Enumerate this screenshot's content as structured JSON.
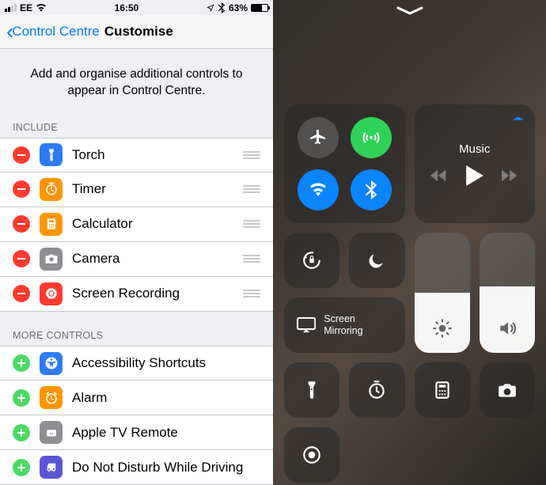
{
  "status": {
    "carrier": "EE",
    "time": "16:50",
    "battery_pct": "63%"
  },
  "nav": {
    "back_label": "Control Centre",
    "title": "Customise"
  },
  "description": "Add and organise additional controls to appear in Control Centre.",
  "section_include": "INCLUDE",
  "section_more": "MORE CONTROLS",
  "include": [
    {
      "label": "Torch",
      "icon": "torch",
      "color": "#2f7bf6"
    },
    {
      "label": "Timer",
      "icon": "timer",
      "color": "#ff9500"
    },
    {
      "label": "Calculator",
      "icon": "calculator",
      "color": "#ff9500"
    },
    {
      "label": "Camera",
      "icon": "camera",
      "color": "#8e8e93"
    },
    {
      "label": "Screen Recording",
      "icon": "record",
      "color": "#ff3b30"
    }
  ],
  "more": [
    {
      "label": "Accessibility Shortcuts",
      "icon": "accessibility",
      "color": "#2f7bf6"
    },
    {
      "label": "Alarm",
      "icon": "alarm",
      "color": "#ff9500"
    },
    {
      "label": "Apple TV Remote",
      "icon": "tv",
      "color": "#8e8e93"
    },
    {
      "label": "Do Not Disturb While Driving",
      "icon": "car-dnd",
      "color": "#5856d6"
    }
  ],
  "cc": {
    "music_label": "Music",
    "mirror_label": "Screen Mirroring",
    "brightness_pct": 50,
    "volume_pct": 55
  }
}
